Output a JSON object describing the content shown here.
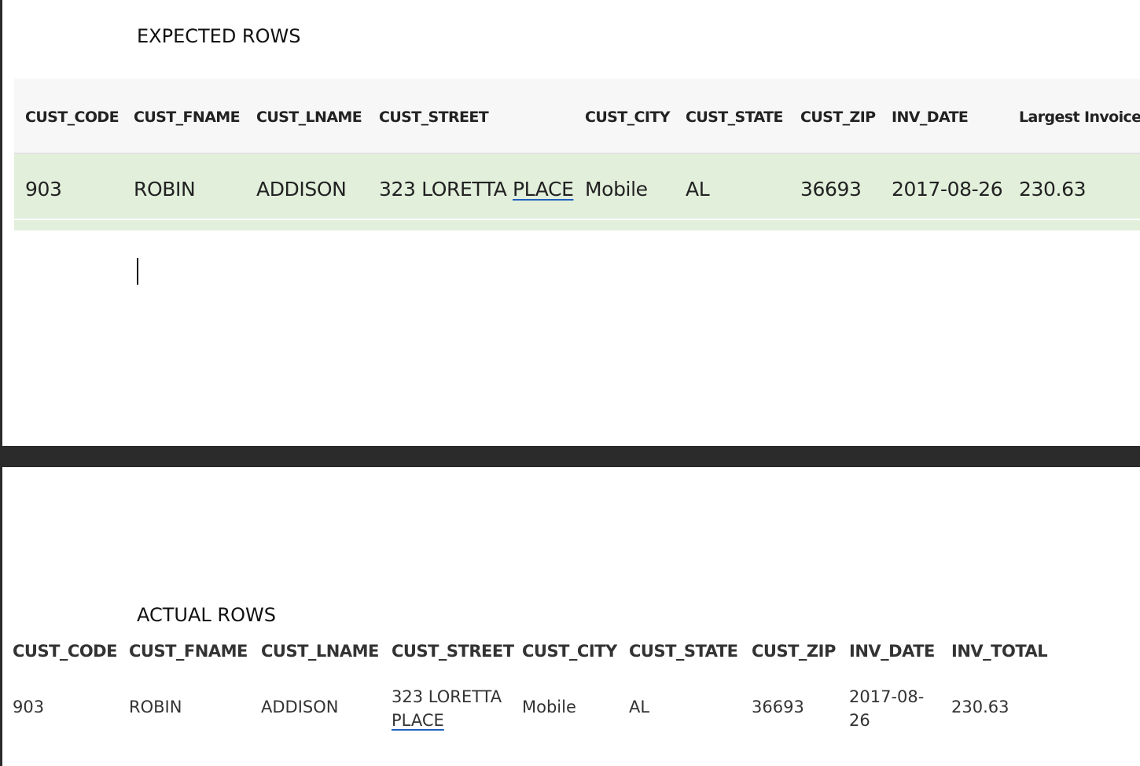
{
  "expected": {
    "title": "EXPECTED ROWS",
    "columns": [
      "CUST_CODE",
      "CUST_FNAME",
      "CUST_LNAME",
      "CUST_STREET",
      "CUST_CITY",
      "CUST_STATE",
      "CUST_ZIP",
      "INV_DATE",
      "Largest Invoice"
    ],
    "rows": [
      {
        "cust_code": "903",
        "cust_fname": "ROBIN",
        "cust_lname": "ADDISON",
        "cust_street_a": "323 LORETTA",
        "cust_street_b": "PLACE",
        "cust_city": "Mobile",
        "cust_state": "AL",
        "cust_zip": "36693",
        "inv_date": "2017-08-26",
        "largest_invoice": "230.63"
      }
    ]
  },
  "actual": {
    "title": "ACTUAL ROWS",
    "columns": [
      "CUST_CODE",
      "CUST_FNAME",
      "CUST_LNAME",
      "CUST_STREET",
      "CUST_CITY",
      "CUST_STATE",
      "CUST_ZIP",
      "INV_DATE",
      "INV_TOTAL"
    ],
    "rows": [
      {
        "cust_code": "903",
        "cust_fname": "ROBIN",
        "cust_lname": "ADDISON",
        "cust_street_a": "323 LORETTA",
        "cust_street_b": "PLACE",
        "cust_city": "Mobile",
        "cust_state": "AL",
        "cust_zip": "36693",
        "inv_date_a": "2017-08-",
        "inv_date_b": "26",
        "inv_total": "230.63"
      }
    ]
  },
  "colors": {
    "expected_row_bg": "#e2efdb",
    "header_bg": "#f7f7f7",
    "divider": "#2b2b2b",
    "spellcheck_underline": "#1f5fbf"
  }
}
